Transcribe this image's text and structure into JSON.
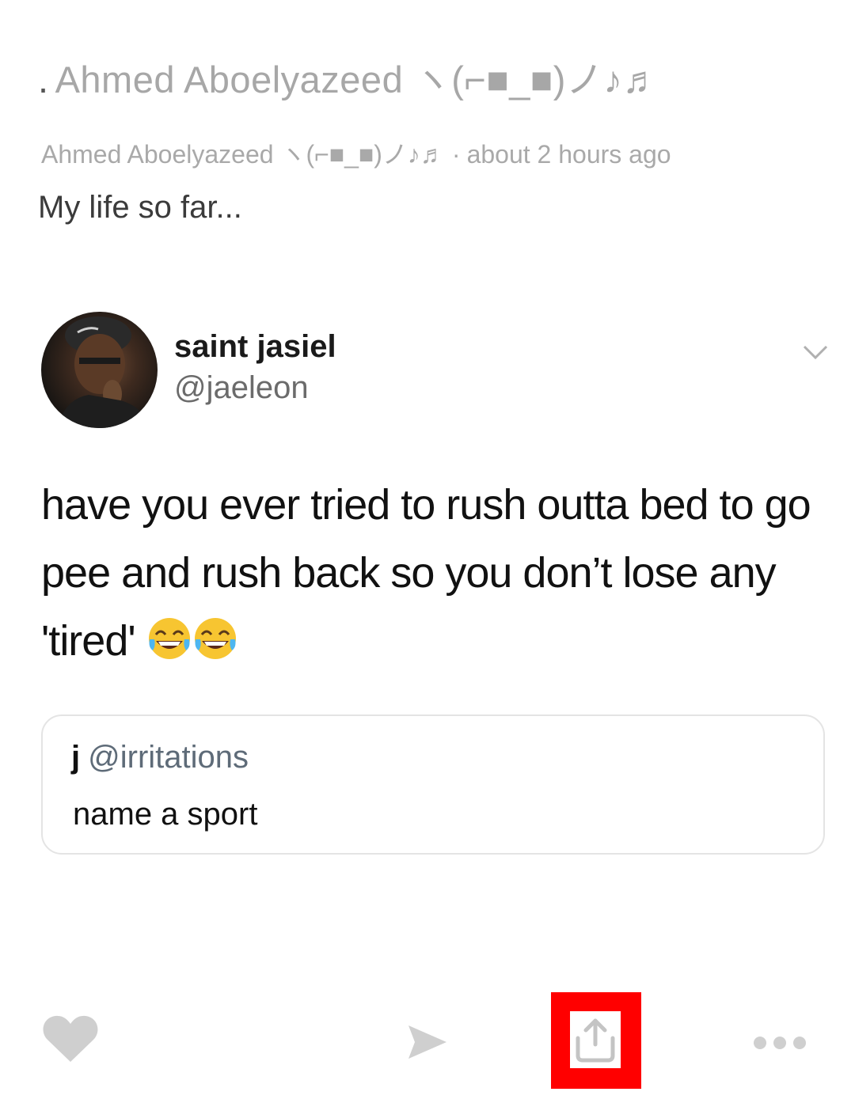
{
  "post": {
    "title": "Ahmed Aboelyazeed ヽ(⌐■_■)ノ♪♬",
    "meta_author": "Ahmed Aboelyazeed ヽ(⌐■_■)ノ♪♬",
    "meta_separator": "·",
    "meta_time": "about 2 hours ago",
    "caption": "My life so far..."
  },
  "tweet": {
    "display_name": "saint jasiel",
    "handle": "@jaeleon",
    "text": "have you ever tried to rush outta bed to go pee and rush back so you don’t lose any 'tired'",
    "emoji": [
      "tears-of-joy",
      "tears-of-joy"
    ],
    "quote": {
      "name": "j",
      "handle": "@irritations",
      "text": "name a sport"
    }
  },
  "actions": {
    "icons": [
      "heart-icon",
      "send-icon",
      "share-icon",
      "more-icon"
    ],
    "highlight_color": "#ff0000"
  }
}
